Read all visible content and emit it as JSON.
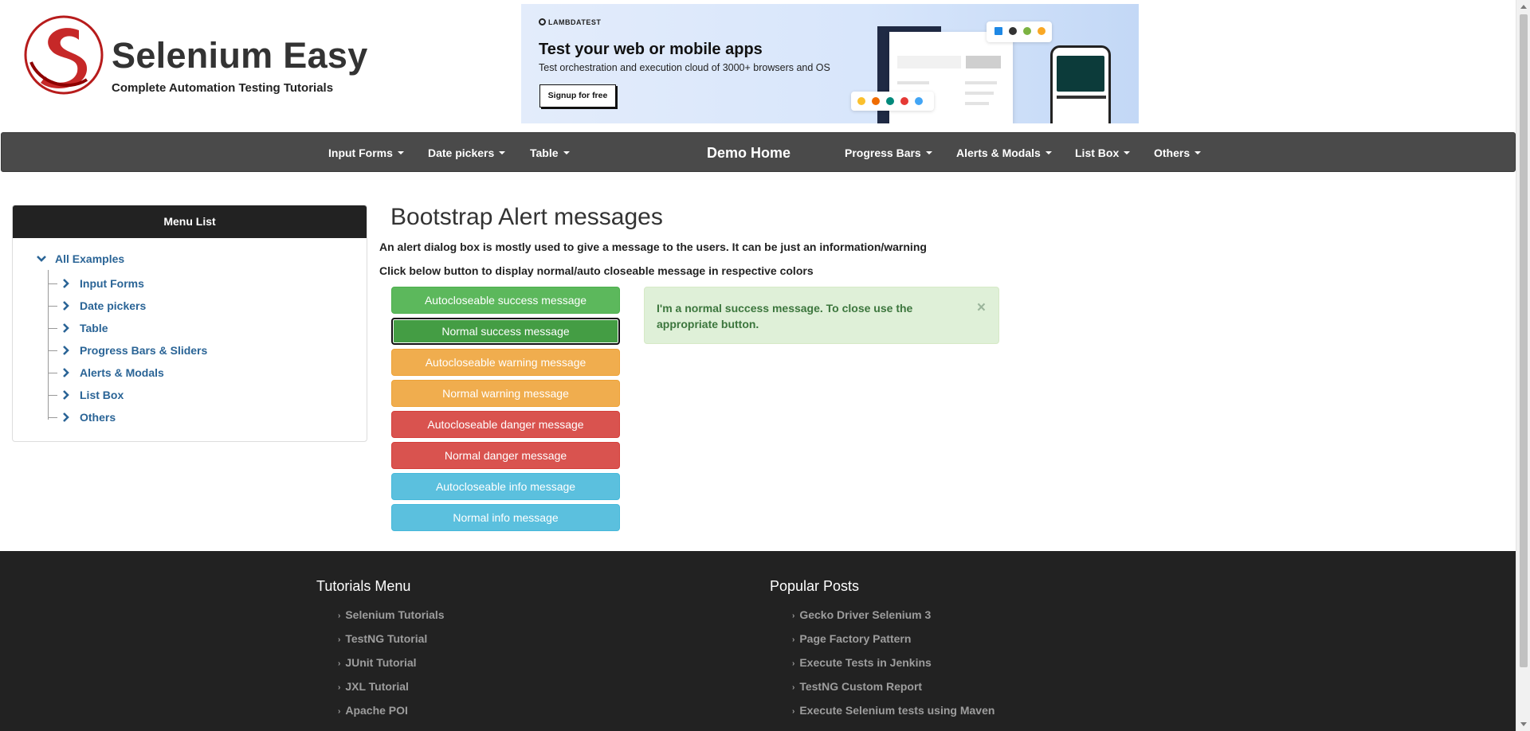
{
  "header": {
    "brand_title": "Selenium Easy",
    "brand_subtitle": "Complete Automation Testing Tutorials",
    "brand_color": "#c62828"
  },
  "ad": {
    "brand": "LAMBDATEST",
    "headline": "Test your web or mobile apps",
    "text": "Test orchestration and execution cloud of 3000+ browsers and OS",
    "button": "Signup for free"
  },
  "navbar": {
    "items_left": [
      "Input Forms",
      "Date pickers",
      "Table"
    ],
    "home": "Demo Home",
    "items_right": [
      "Progress Bars",
      "Alerts & Modals",
      "List Box",
      "Others"
    ]
  },
  "sidebar": {
    "title": "Menu List",
    "root": "All Examples",
    "items": [
      "Input Forms",
      "Date pickers",
      "Table",
      "Progress Bars & Sliders",
      "Alerts & Modals",
      "List Box",
      "Others"
    ]
  },
  "main": {
    "title": "Bootstrap Alert messages",
    "description1": "An alert dialog box is mostly used to give a message to the users. It can be just an information/warning",
    "description2": "Click below button to display normal/auto closeable message in respective colors",
    "buttons": [
      "Autocloseable success message",
      "Normal success message",
      "Autocloseable warning message",
      "Normal warning message",
      "Autocloseable danger message",
      "Normal danger message",
      "Autocloseable info message",
      "Normal info message"
    ],
    "alert": {
      "text": "I'm a normal success message. To close use the appropriate button.",
      "close": "×"
    }
  },
  "footer": {
    "col1_title": "Tutorials Menu",
    "col1_links": [
      "Selenium Tutorials",
      "TestNG Tutorial",
      "JUnit Tutorial",
      "JXL Tutorial",
      "Apache POI"
    ],
    "col2_title": "Popular Posts",
    "col2_links": [
      "Gecko Driver Selenium 3",
      "Page Factory Pattern",
      "Execute Tests in Jenkins",
      "TestNG Custom Report",
      "Execute Selenium tests using Maven"
    ]
  },
  "colors": {
    "success": "#5cb85c",
    "warning": "#f0ad4e",
    "danger": "#d9534f",
    "info": "#5bc0de",
    "navbar": "#4a4a4a",
    "footer": "#222222",
    "link": "#2a6496"
  }
}
